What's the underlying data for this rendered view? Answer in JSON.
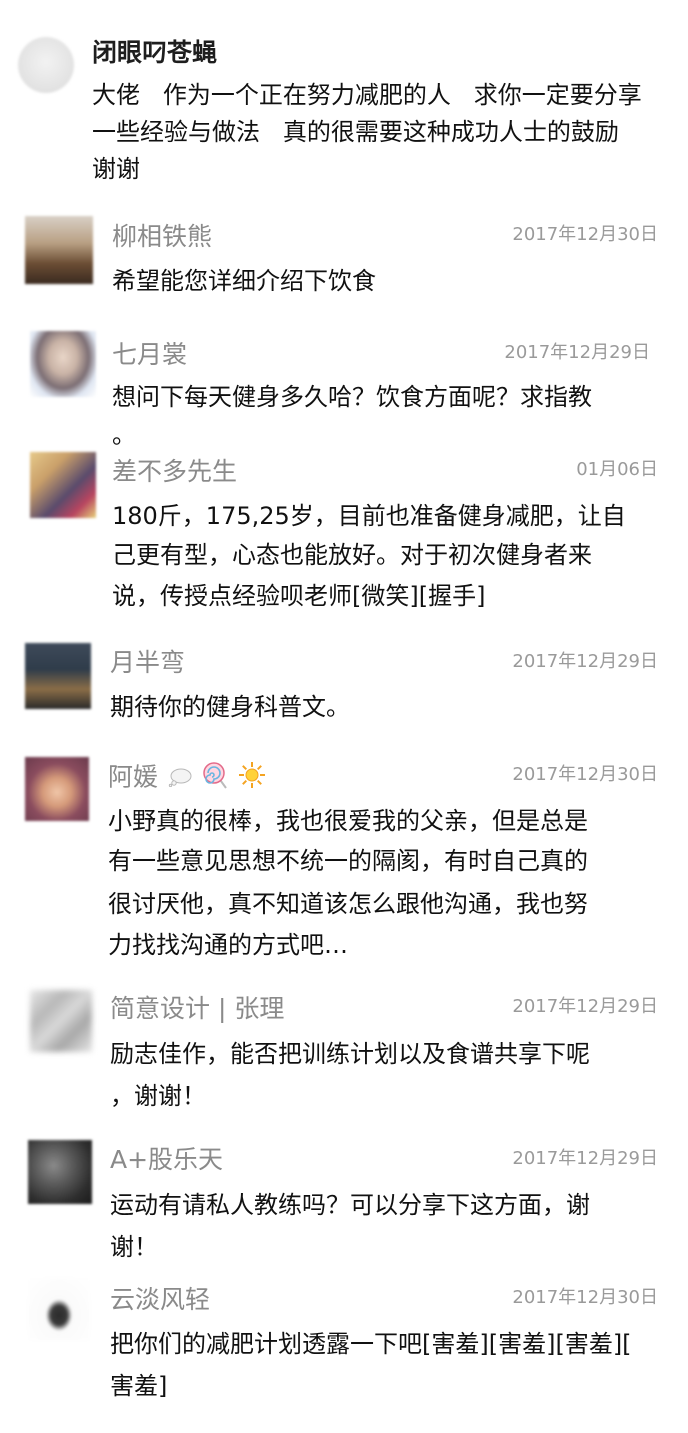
{
  "comments": [
    {
      "name": "闭眼叼苍蝇",
      "date": "",
      "lines": [
        "大佬   作为一个正在努力减肥的人   求你一定要分享",
        "一些经验与做法   真的很需要这种成功人士的鼓励",
        "谢谢"
      ]
    },
    {
      "name": "柳相铁熊",
      "date": "2017年12月30日",
      "lines": [
        "希望能您详细介绍下饮食"
      ]
    },
    {
      "name": "七月裳",
      "date": "2017年12月29日",
      "lines": [
        "想问下每天健身多久哈？饮食方面呢？求指教",
        "。"
      ]
    },
    {
      "name": "差不多先生",
      "date": "01月06日",
      "lines": [
        "180斤，175,25岁，目前也准备健身减肥，让自",
        "己更有型，心态也能放好。对于初次健身者来",
        "说，传授点经验呗老师[微笑][握手]"
      ]
    },
    {
      "name": "月半弯",
      "date": "2017年12月29日",
      "lines": [
        "期待你的健身科普文。"
      ]
    },
    {
      "name": "阿媛",
      "date": "2017年12月30日",
      "emoji_icons": [
        "thought-bubble-icon",
        "lollipop-icon",
        "sun-icon"
      ],
      "lines": [
        "小野真的很棒，我也很爱我的父亲，但是总是",
        "有一些意见思想不统一的隔阂，有时自己真的",
        "很讨厌他，真不知道该怎么跟他沟通，我也努",
        "力找找沟通的方式吧…"
      ]
    },
    {
      "name": "简意设计 | 张理",
      "date": "2017年12月29日",
      "lines": [
        "励志佳作，能否把训练计划以及食谱共享下呢",
        "，谢谢！"
      ]
    },
    {
      "name": "A+股乐天",
      "date": "2017年12月29日",
      "lines": [
        "运动有请私人教练吗？可以分享下这方面，谢",
        "谢！"
      ]
    },
    {
      "name": "云淡风轻",
      "date": "2017年12月30日",
      "lines": [
        "把你们的减肥计划透露一下吧[害羞][害羞][害羞][",
        "害羞]"
      ]
    }
  ]
}
